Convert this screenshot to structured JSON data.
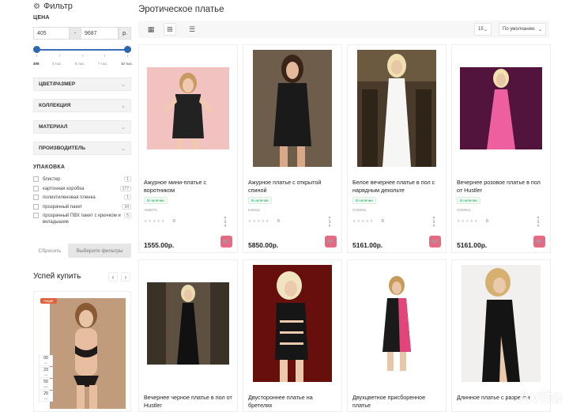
{
  "filter": {
    "title": "Фильтр",
    "price_label": "ЦЕНА",
    "price_min": "405",
    "price_dash": "-",
    "price_max": "9687",
    "currency": "р.",
    "ticks": [
      "405",
      "3 тыс.",
      "6 тыс.",
      "7 тыс.",
      "10 тыс."
    ],
    "accordions": [
      "ЦВЕТ/РАЗМЕР",
      "КОЛЛЕКЦИЯ",
      "МАТЕРИАЛ",
      "ПРОИЗВОДИТЕЛЬ"
    ],
    "pack_label": "УПАКОВКА",
    "pack_items": [
      {
        "label": "блистер",
        "count": "1"
      },
      {
        "label": "картонная коробка",
        "count": "177"
      },
      {
        "label": "полиэтиленовая пленка",
        "count": "1"
      },
      {
        "label": "прозрачный пакет",
        "count": "34"
      },
      {
        "label": "прозрачный ПВХ пакет с крючком и вкладышем",
        "count": "5"
      }
    ],
    "reset_label": "Сбросить",
    "apply_label": "Выберите фильтры"
  },
  "hurry": {
    "title": "Успей купить",
    "prev": "‹",
    "next": "›",
    "badge": "Акция",
    "timer": [
      {
        "v": "09",
        "u": "дн"
      },
      {
        "v": "23",
        "u": "час"
      },
      {
        "v": "59",
        "u": "мин"
      },
      {
        "v": "29",
        "u": "сек"
      }
    ]
  },
  "main": {
    "title": "Эротическое платье",
    "per_page": "15",
    "sort": "По умолчанию"
  },
  "products": [
    {
      "name": "Ажурное мини-платье с воротником",
      "avail": "В наличии",
      "sku": "AM6076",
      "reviews": "0",
      "price": "1555.00р."
    },
    {
      "name": "Ажурное платье с открытой спиной",
      "avail": "В наличии",
      "sku": "646042",
      "reviews": "0",
      "price": "5850.00р."
    },
    {
      "name": "Белое вечернее платье в пол с нарядным декольте",
      "avail": "В наличии",
      "sku": "GOWN5",
      "reviews": "0",
      "price": "5161.00р."
    },
    {
      "name": "Вечернее розовое платье в пол от Hustler",
      "avail": "В наличии",
      "sku": "GOWN3",
      "reviews": "0",
      "price": "5161.00р."
    },
    {
      "name": "Вечернее черное платье в пол от Hustler",
      "avail": "",
      "sku": "",
      "reviews": "",
      "price": ""
    },
    {
      "name": "Двустороннее платье на бретелях",
      "avail": "",
      "sku": "",
      "reviews": "",
      "price": ""
    },
    {
      "name": "Двухцветное присборенное платье",
      "avail": "",
      "sku": "",
      "reviews": "",
      "price": ""
    },
    {
      "name": "Длинное платье с разрезом",
      "avail": "",
      "sku": "",
      "reviews": "",
      "price": ""
    }
  ],
  "watermark": "Avito",
  "colors": {
    "accent": "#2f66b0",
    "cart": "#e66b82",
    "in_stock": "#29a35a"
  }
}
